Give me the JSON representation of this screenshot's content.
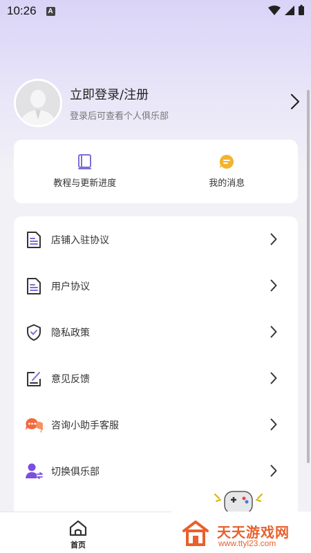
{
  "status_bar": {
    "time": "10:26",
    "notification_letter": "A"
  },
  "profile": {
    "title": "立即登录/注册",
    "subtitle": "登录后可查看个人俱乐部"
  },
  "quick_actions": [
    {
      "label": "教程与更新进度",
      "icon": "book-icon",
      "color": "#7b6fd6"
    },
    {
      "label": "我的消息",
      "icon": "message-icon",
      "color": "#f3b32e"
    }
  ],
  "menu": [
    {
      "label": "店铺入驻协议",
      "icon": "document-icon"
    },
    {
      "label": "用户协议",
      "icon": "document-icon"
    },
    {
      "label": "隐私政策",
      "icon": "shield-check-icon"
    },
    {
      "label": "意见反馈",
      "icon": "edit-icon"
    },
    {
      "label": "咨询小助手客服",
      "icon": "chat-bubbles-icon",
      "color": "#f26a3d"
    },
    {
      "label": "切换俱乐部",
      "icon": "user-switch-icon",
      "color": "#7b4fe0"
    }
  ],
  "bottom_nav": {
    "home_label": "首页"
  },
  "watermark": {
    "title": "天天游戏网",
    "url": "www.ttyl23.com"
  }
}
